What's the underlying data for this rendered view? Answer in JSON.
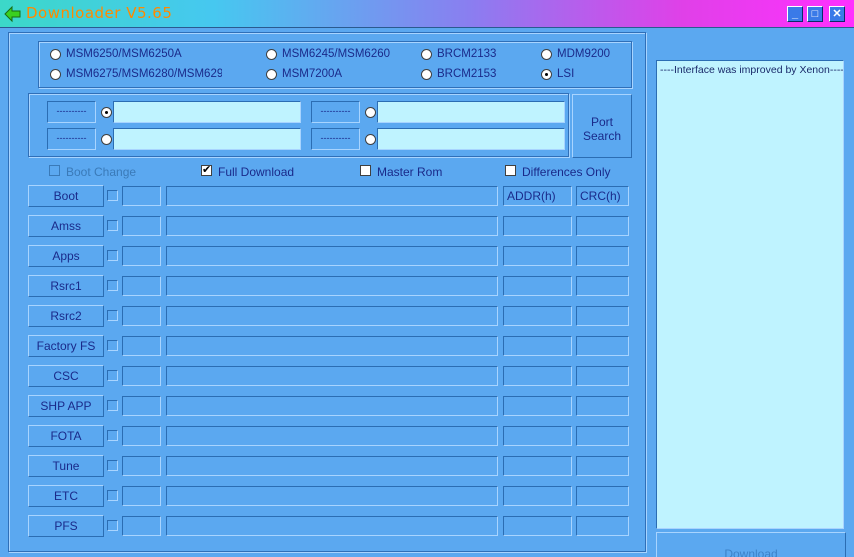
{
  "window": {
    "title": "Downloader V5.65",
    "min_glyph": "_",
    "max_glyph": "□",
    "close_glyph": "✕"
  },
  "chipsets": [
    {
      "label": "MSM6250/MSM6250A",
      "selected": false
    },
    {
      "label": "MSM6245/MSM6260",
      "selected": false
    },
    {
      "label": "BRCM2133",
      "selected": false
    },
    {
      "label": "MDM9200",
      "selected": false
    },
    {
      "label": "MSM6275/MSM6280/MSM6290",
      "selected": false
    },
    {
      "label": "MSM7200A",
      "selected": false
    },
    {
      "label": "BRCM2153",
      "selected": false
    },
    {
      "label": "LSI",
      "selected": true
    }
  ],
  "ports": [
    {
      "tag": "----------",
      "value": "",
      "selected": true
    },
    {
      "tag": "----------",
      "value": "",
      "selected": false
    },
    {
      "tag": "----------",
      "value": "",
      "selected": false
    },
    {
      "tag": "----------",
      "value": "",
      "selected": false
    }
  ],
  "port_search_label": "Port Search",
  "port_search_line1": "Port",
  "port_search_line2": "Search",
  "options": {
    "boot_change": {
      "label": "Boot Change",
      "checked": false,
      "enabled": false
    },
    "full_download": {
      "label": "Full Download",
      "checked": true,
      "enabled": true
    },
    "master_rom": {
      "label": "Master Rom",
      "checked": false,
      "enabled": true
    },
    "differences_only": {
      "label": "Differences Only",
      "checked": false,
      "enabled": true
    }
  },
  "columns": {
    "addr": "ADDR(h)",
    "crc": "CRC(h)"
  },
  "files": [
    {
      "label": "Boot"
    },
    {
      "label": "Amss"
    },
    {
      "label": "Apps"
    },
    {
      "label": "Rsrc1"
    },
    {
      "label": "Rsrc2"
    },
    {
      "label": "Factory FS"
    },
    {
      "label": "CSC"
    },
    {
      "label": "SHP APP"
    },
    {
      "label": "FOTA"
    },
    {
      "label": "Tune"
    },
    {
      "label": "ETC"
    },
    {
      "label": "PFS"
    }
  ],
  "log": {
    "text": "----Interface was improved by Xenon----"
  },
  "download_label": "Download",
  "colors": {
    "background": "#5ba8f0",
    "field": "#bff3ff",
    "text": "#1a2a8a",
    "title_text": "#ff8a00"
  },
  "icons": {
    "app": "green-arrow-icon",
    "minimize": "minimize-icon",
    "maximize": "maximize-icon",
    "close": "close-icon"
  }
}
